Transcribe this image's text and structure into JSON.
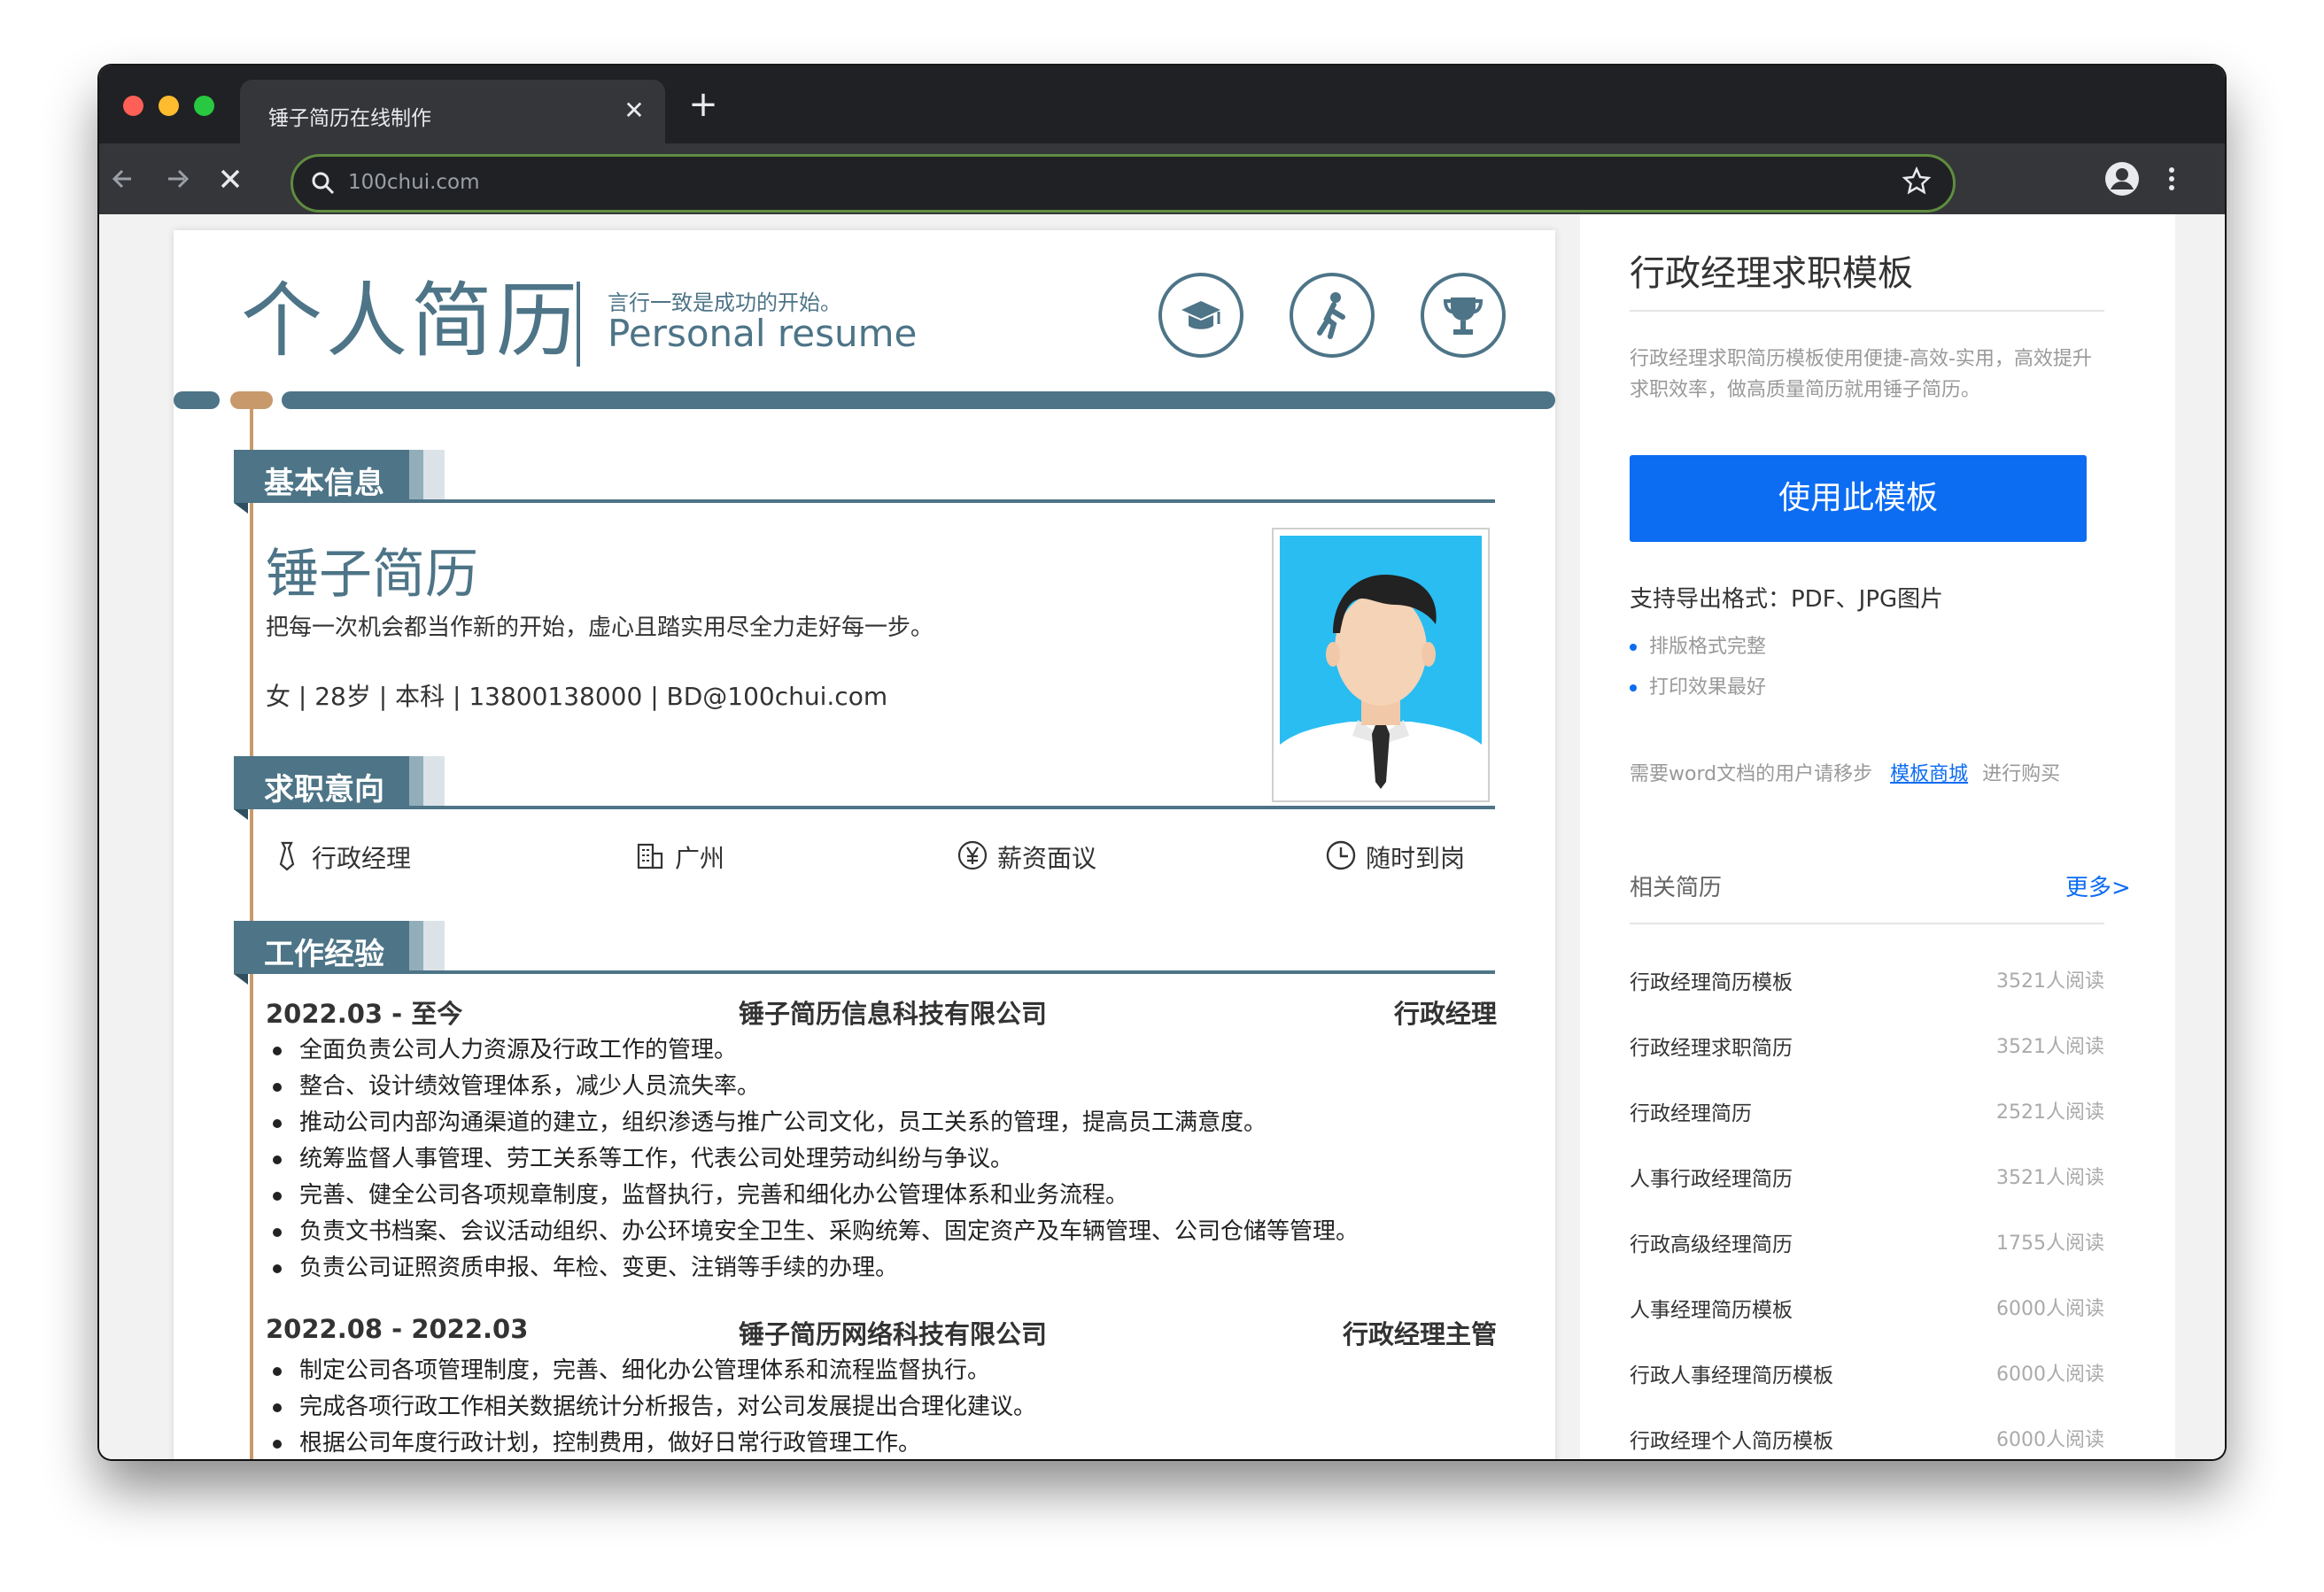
{
  "browser": {
    "tab_title": "锤子简历在线制作",
    "tab_close": "✕",
    "new_tab": "+",
    "url": "100chui.com"
  },
  "resume": {
    "header": {
      "title_cn": "个人简历",
      "motto": "言行一致是成功的开始。",
      "title_en": "Personal resume",
      "icons": [
        "graduation-cap-icon",
        "walking-person-icon",
        "trophy-icon"
      ]
    },
    "sections": {
      "basic": "基本信息",
      "intent": "求职意向",
      "work": "工作经验"
    },
    "profile": {
      "name": "锤子简历",
      "slogan": "把每一次机会都当作新的开始，虚心且踏实用尽全力走好每一步。",
      "contact": "女 | 28岁 | 本科 | 13800138000 | BD@100chui.com"
    },
    "intent": [
      {
        "icon": "tie-icon",
        "label": "行政经理"
      },
      {
        "icon": "building-icon",
        "label": "广州"
      },
      {
        "icon": "yen-icon",
        "label": "薪资面议"
      },
      {
        "icon": "clock-icon",
        "label": "随时到岗"
      }
    ],
    "jobs": [
      {
        "date": "2022.03 - 至今",
        "company": "锤子简历信息科技有限公司",
        "role": "行政经理",
        "bullets": [
          "全面负责公司人力资源及行政工作的管理。",
          "整合、设计绩效管理体系，减少人员流失率。",
          "推动公司内部沟通渠道的建立，组织渗透与推广公司文化，员工关系的管理，提高员工满意度。",
          "统筹监督人事管理、劳工关系等工作，代表公司处理劳动纠纷与争议。",
          "完善、健全公司各项规章制度，监督执行，完善和细化办公管理体系和业务流程。",
          "负责文书档案、会议活动组织、办公环境安全卫生、采购统筹、固定资产及车辆管理、公司仓储等管理。",
          "负责公司证照资质申报、年检、变更、注销等手续的办理。"
        ]
      },
      {
        "date": "2022.08 - 2022.03",
        "company": "锤子简历网络科技有限公司",
        "role": "行政经理主管",
        "bullets": [
          "制定公司各项管理制度，完善、细化办公管理体系和流程监督执行。",
          "完成各项行政工作相关数据统计分析报告，对公司发展提出合理化建议。",
          "根据公司年度行政计划，控制费用，做好日常行政管理工作。"
        ]
      }
    ]
  },
  "sidebar": {
    "title": "行政经理求职模板",
    "description": "行政经理求职简历模板使用便捷-高效-实用，高效提升求职效率，做高质量简历就用锤子简历。",
    "use_button": "使用此模板",
    "formats": "支持导出格式：PDF、JPG图片",
    "features": [
      "排版格式完整",
      "打印效果最好"
    ],
    "word_note_prefix": "需要word文档的用户请移步",
    "word_note_link": "模板商城",
    "word_note_suffix": "进行购买",
    "related_label": "相关简历",
    "related_more": "更多>",
    "related": [
      {
        "title": "行政经理简历模板",
        "views": "3521人阅读"
      },
      {
        "title": "行政经理求职简历",
        "views": "3521人阅读"
      },
      {
        "title": "行政经理简历",
        "views": "2521人阅读"
      },
      {
        "title": "人事行政经理简历",
        "views": "3521人阅读"
      },
      {
        "title": "行政高级经理简历",
        "views": "1755人阅读"
      },
      {
        "title": "人事经理简历模板",
        "views": "6000人阅读"
      },
      {
        "title": "行政人事经理简历模板",
        "views": "6000人阅读"
      },
      {
        "title": "行政经理个人简历模板",
        "views": "6000人阅读"
      }
    ]
  },
  "colors": {
    "accent_teal": "#4d7487",
    "accent_gold": "#c89a6b",
    "primary_blue": "#0c6cf2",
    "photo_bg": "#29bdf2"
  }
}
